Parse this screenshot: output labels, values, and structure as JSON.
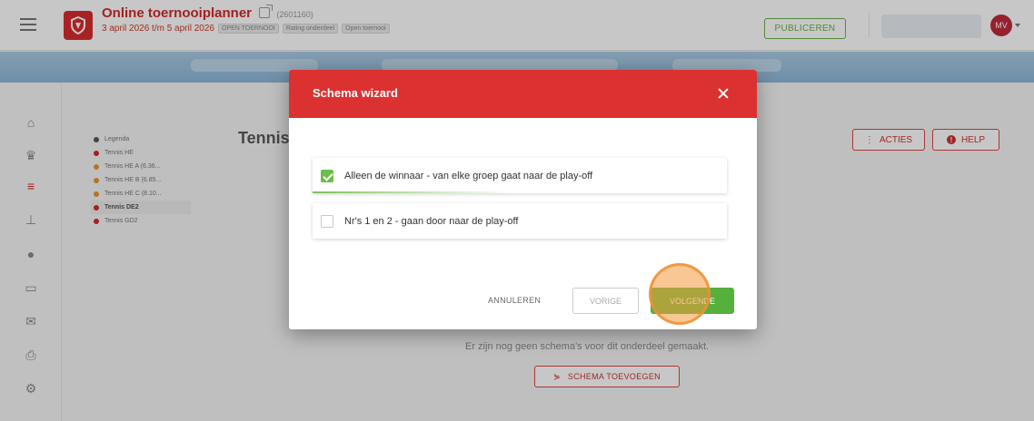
{
  "topbar": {
    "app_title": "Online toernooiplanner",
    "app_id": "(2601160)",
    "date_range": "3 april 2026 t/m 5 april 2026",
    "tags": [
      "OPEN TOERNOOI",
      "Rating onderdeel",
      "Open toernooi"
    ],
    "publish_label": "PUBLICEREN",
    "avatar_initials": "MV",
    "icons": {
      "menu": "hamburger-icon",
      "logo": "shield-logo-icon",
      "external": "external-link-icon"
    }
  },
  "sidebar": {
    "items": [
      {
        "icon": "home-icon",
        "glyph": "⌂",
        "active": false
      },
      {
        "icon": "trophy-icon",
        "glyph": "♛",
        "active": false
      },
      {
        "icon": "list-icon",
        "glyph": "≡",
        "active": true
      },
      {
        "icon": "bracket-icon",
        "glyph": "⊥",
        "active": false
      },
      {
        "icon": "ball-icon",
        "glyph": "●",
        "active": false
      },
      {
        "icon": "monitor-icon",
        "glyph": "▭",
        "active": false
      },
      {
        "icon": "mail-icon",
        "glyph": "✉",
        "active": false
      },
      {
        "icon": "print-icon",
        "glyph": "⎙",
        "active": false
      },
      {
        "icon": "settings-icon",
        "glyph": "⚙",
        "active": false
      }
    ]
  },
  "legend": {
    "title": "Legenda",
    "items": [
      {
        "label": "Tennis HE",
        "color": "#d12a2a",
        "selected": false
      },
      {
        "label": "Tennis HE A (6.36...",
        "color": "#e8962a",
        "selected": false
      },
      {
        "label": "Tennis HE B (6.85...",
        "color": "#e8962a",
        "selected": false
      },
      {
        "label": "Tennis HE C (8.10...",
        "color": "#e8962a",
        "selected": false
      },
      {
        "label": "Tennis DE2",
        "color": "#d12a2a",
        "selected": true
      },
      {
        "label": "Tennis GD2",
        "color": "#d12a2a",
        "selected": false
      }
    ]
  },
  "page": {
    "heading": "Tennis",
    "acties_label": "ACTIES",
    "help_label": "HELP",
    "empty_message": "Er zijn nog geen schema's voor dit onderdeel gemaakt.",
    "add_schema_label": "SCHEMA TOEVOEGEN"
  },
  "modal": {
    "title": "Schema wizard",
    "options": [
      {
        "label": "Alleen de winnaar - van elke groep gaat naar de play-off",
        "checked": true
      },
      {
        "label": "Nr's 1 en 2 - gaan door naar de play-off",
        "checked": false
      }
    ],
    "cancel_label": "ANNULEREN",
    "prev_label": "VORIGE",
    "next_label": "VOLGENDE"
  },
  "colors": {
    "brand_red": "#dc3131",
    "success_green": "#55b03c",
    "click_highlight": "#f2993c"
  }
}
